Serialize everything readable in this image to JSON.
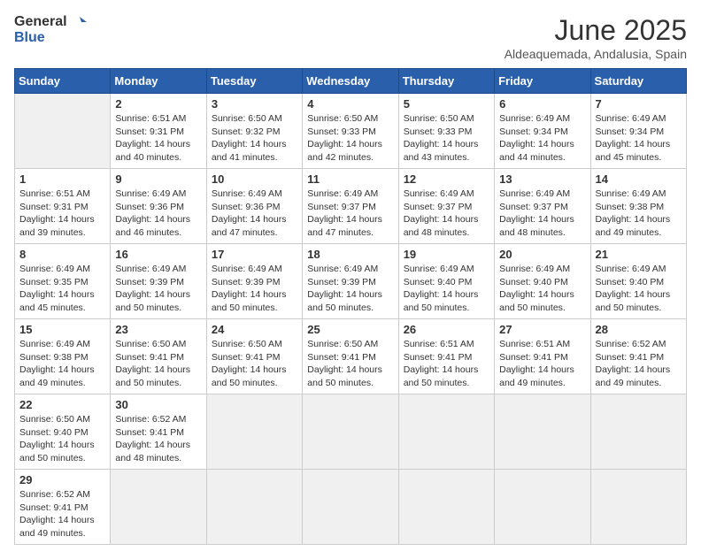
{
  "header": {
    "logo_general": "General",
    "logo_blue": "Blue",
    "title": "June 2025",
    "subtitle": "Aldeaquemada, Andalusia, Spain"
  },
  "calendar": {
    "days_of_week": [
      "Sunday",
      "Monday",
      "Tuesday",
      "Wednesday",
      "Thursday",
      "Friday",
      "Saturday"
    ],
    "weeks": [
      [
        null,
        {
          "day": 2,
          "sunrise": "6:51 AM",
          "sunset": "9:31 PM",
          "daylight": "14 hours and 40 minutes."
        },
        {
          "day": 3,
          "sunrise": "6:50 AM",
          "sunset": "9:32 PM",
          "daylight": "14 hours and 41 minutes."
        },
        {
          "day": 4,
          "sunrise": "6:50 AM",
          "sunset": "9:33 PM",
          "daylight": "14 hours and 42 minutes."
        },
        {
          "day": 5,
          "sunrise": "6:50 AM",
          "sunset": "9:33 PM",
          "daylight": "14 hours and 43 minutes."
        },
        {
          "day": 6,
          "sunrise": "6:49 AM",
          "sunset": "9:34 PM",
          "daylight": "14 hours and 44 minutes."
        },
        {
          "day": 7,
          "sunrise": "6:49 AM",
          "sunset": "9:34 PM",
          "daylight": "14 hours and 45 minutes."
        }
      ],
      [
        {
          "day": 1,
          "sunrise": "6:51 AM",
          "sunset": "9:31 PM",
          "daylight": "14 hours and 39 minutes."
        },
        {
          "day": 9,
          "sunrise": "6:49 AM",
          "sunset": "9:36 PM",
          "daylight": "14 hours and 46 minutes."
        },
        {
          "day": 10,
          "sunrise": "6:49 AM",
          "sunset": "9:36 PM",
          "daylight": "14 hours and 47 minutes."
        },
        {
          "day": 11,
          "sunrise": "6:49 AM",
          "sunset": "9:37 PM",
          "daylight": "14 hours and 47 minutes."
        },
        {
          "day": 12,
          "sunrise": "6:49 AM",
          "sunset": "9:37 PM",
          "daylight": "14 hours and 48 minutes."
        },
        {
          "day": 13,
          "sunrise": "6:49 AM",
          "sunset": "9:37 PM",
          "daylight": "14 hours and 48 minutes."
        },
        {
          "day": 14,
          "sunrise": "6:49 AM",
          "sunset": "9:38 PM",
          "daylight": "14 hours and 49 minutes."
        }
      ],
      [
        {
          "day": 8,
          "sunrise": "6:49 AM",
          "sunset": "9:35 PM",
          "daylight": "14 hours and 45 minutes."
        },
        {
          "day": 16,
          "sunrise": "6:49 AM",
          "sunset": "9:39 PM",
          "daylight": "14 hours and 50 minutes."
        },
        {
          "day": 17,
          "sunrise": "6:49 AM",
          "sunset": "9:39 PM",
          "daylight": "14 hours and 50 minutes."
        },
        {
          "day": 18,
          "sunrise": "6:49 AM",
          "sunset": "9:39 PM",
          "daylight": "14 hours and 50 minutes."
        },
        {
          "day": 19,
          "sunrise": "6:49 AM",
          "sunset": "9:40 PM",
          "daylight": "14 hours and 50 minutes."
        },
        {
          "day": 20,
          "sunrise": "6:49 AM",
          "sunset": "9:40 PM",
          "daylight": "14 hours and 50 minutes."
        },
        {
          "day": 21,
          "sunrise": "6:49 AM",
          "sunset": "9:40 PM",
          "daylight": "14 hours and 50 minutes."
        }
      ],
      [
        {
          "day": 15,
          "sunrise": "6:49 AM",
          "sunset": "9:38 PM",
          "daylight": "14 hours and 49 minutes."
        },
        {
          "day": 23,
          "sunrise": "6:50 AM",
          "sunset": "9:41 PM",
          "daylight": "14 hours and 50 minutes."
        },
        {
          "day": 24,
          "sunrise": "6:50 AM",
          "sunset": "9:41 PM",
          "daylight": "14 hours and 50 minutes."
        },
        {
          "day": 25,
          "sunrise": "6:50 AM",
          "sunset": "9:41 PM",
          "daylight": "14 hours and 50 minutes."
        },
        {
          "day": 26,
          "sunrise": "6:51 AM",
          "sunset": "9:41 PM",
          "daylight": "14 hours and 50 minutes."
        },
        {
          "day": 27,
          "sunrise": "6:51 AM",
          "sunset": "9:41 PM",
          "daylight": "14 hours and 49 minutes."
        },
        {
          "day": 28,
          "sunrise": "6:52 AM",
          "sunset": "9:41 PM",
          "daylight": "14 hours and 49 minutes."
        }
      ],
      [
        {
          "day": 22,
          "sunrise": "6:50 AM",
          "sunset": "9:40 PM",
          "daylight": "14 hours and 50 minutes."
        },
        {
          "day": 30,
          "sunrise": "6:52 AM",
          "sunset": "9:41 PM",
          "daylight": "14 hours and 48 minutes."
        },
        null,
        null,
        null,
        null,
        null
      ],
      [
        {
          "day": 29,
          "sunrise": "6:52 AM",
          "sunset": "9:41 PM",
          "daylight": "14 hours and 49 minutes."
        },
        null,
        null,
        null,
        null,
        null,
        null
      ]
    ],
    "week_order": [
      [
        1,
        2,
        3,
        4,
        5,
        6,
        7
      ],
      [
        8,
        9,
        10,
        11,
        12,
        13,
        14
      ],
      [
        15,
        16,
        17,
        18,
        19,
        20,
        21
      ],
      [
        22,
        23,
        24,
        25,
        26,
        27,
        28
      ],
      [
        29,
        30,
        null,
        null,
        null,
        null,
        null
      ]
    ],
    "cells": {
      "1": {
        "day": 1,
        "sunrise": "6:51 AM",
        "sunset": "9:31 PM",
        "daylight": "14 hours and 39 minutes."
      },
      "2": {
        "day": 2,
        "sunrise": "6:51 AM",
        "sunset": "9:31 PM",
        "daylight": "14 hours and 40 minutes."
      },
      "3": {
        "day": 3,
        "sunrise": "6:50 AM",
        "sunset": "9:32 PM",
        "daylight": "14 hours and 41 minutes."
      },
      "4": {
        "day": 4,
        "sunrise": "6:50 AM",
        "sunset": "9:33 PM",
        "daylight": "14 hours and 42 minutes."
      },
      "5": {
        "day": 5,
        "sunrise": "6:50 AM",
        "sunset": "9:33 PM",
        "daylight": "14 hours and 43 minutes."
      },
      "6": {
        "day": 6,
        "sunrise": "6:49 AM",
        "sunset": "9:34 PM",
        "daylight": "14 hours and 44 minutes."
      },
      "7": {
        "day": 7,
        "sunrise": "6:49 AM",
        "sunset": "9:34 PM",
        "daylight": "14 hours and 45 minutes."
      },
      "8": {
        "day": 8,
        "sunrise": "6:49 AM",
        "sunset": "9:35 PM",
        "daylight": "14 hours and 45 minutes."
      },
      "9": {
        "day": 9,
        "sunrise": "6:49 AM",
        "sunset": "9:36 PM",
        "daylight": "14 hours and 46 minutes."
      },
      "10": {
        "day": 10,
        "sunrise": "6:49 AM",
        "sunset": "9:36 PM",
        "daylight": "14 hours and 47 minutes."
      },
      "11": {
        "day": 11,
        "sunrise": "6:49 AM",
        "sunset": "9:37 PM",
        "daylight": "14 hours and 47 minutes."
      },
      "12": {
        "day": 12,
        "sunrise": "6:49 AM",
        "sunset": "9:37 PM",
        "daylight": "14 hours and 48 minutes."
      },
      "13": {
        "day": 13,
        "sunrise": "6:49 AM",
        "sunset": "9:37 PM",
        "daylight": "14 hours and 48 minutes."
      },
      "14": {
        "day": 14,
        "sunrise": "6:49 AM",
        "sunset": "9:38 PM",
        "daylight": "14 hours and 49 minutes."
      },
      "15": {
        "day": 15,
        "sunrise": "6:49 AM",
        "sunset": "9:38 PM",
        "daylight": "14 hours and 49 minutes."
      },
      "16": {
        "day": 16,
        "sunrise": "6:49 AM",
        "sunset": "9:39 PM",
        "daylight": "14 hours and 50 minutes."
      },
      "17": {
        "day": 17,
        "sunrise": "6:49 AM",
        "sunset": "9:39 PM",
        "daylight": "14 hours and 50 minutes."
      },
      "18": {
        "day": 18,
        "sunrise": "6:49 AM",
        "sunset": "9:39 PM",
        "daylight": "14 hours and 50 minutes."
      },
      "19": {
        "day": 19,
        "sunrise": "6:49 AM",
        "sunset": "9:40 PM",
        "daylight": "14 hours and 50 minutes."
      },
      "20": {
        "day": 20,
        "sunrise": "6:49 AM",
        "sunset": "9:40 PM",
        "daylight": "14 hours and 50 minutes."
      },
      "21": {
        "day": 21,
        "sunrise": "6:49 AM",
        "sunset": "9:40 PM",
        "daylight": "14 hours and 50 minutes."
      },
      "22": {
        "day": 22,
        "sunrise": "6:50 AM",
        "sunset": "9:40 PM",
        "daylight": "14 hours and 50 minutes."
      },
      "23": {
        "day": 23,
        "sunrise": "6:50 AM",
        "sunset": "9:41 PM",
        "daylight": "14 hours and 50 minutes."
      },
      "24": {
        "day": 24,
        "sunrise": "6:50 AM",
        "sunset": "9:41 PM",
        "daylight": "14 hours and 50 minutes."
      },
      "25": {
        "day": 25,
        "sunrise": "6:50 AM",
        "sunset": "9:41 PM",
        "daylight": "14 hours and 50 minutes."
      },
      "26": {
        "day": 26,
        "sunrise": "6:51 AM",
        "sunset": "9:41 PM",
        "daylight": "14 hours and 50 minutes."
      },
      "27": {
        "day": 27,
        "sunrise": "6:51 AM",
        "sunset": "9:41 PM",
        "daylight": "14 hours and 49 minutes."
      },
      "28": {
        "day": 28,
        "sunrise": "6:52 AM",
        "sunset": "9:41 PM",
        "daylight": "14 hours and 49 minutes."
      },
      "29": {
        "day": 29,
        "sunrise": "6:52 AM",
        "sunset": "9:41 PM",
        "daylight": "14 hours and 49 minutes."
      },
      "30": {
        "day": 30,
        "sunrise": "6:52 AM",
        "sunset": "9:41 PM",
        "daylight": "14 hours and 48 minutes."
      }
    }
  }
}
